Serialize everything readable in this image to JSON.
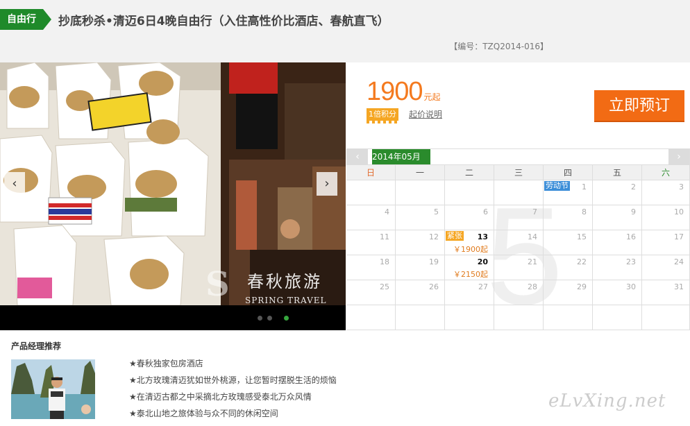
{
  "header": {
    "tag": "自由行",
    "title": "抄底秒杀•清迈6日4晚自由行（入住高性价比酒店、春航直飞）",
    "code": "【编号：TZQ2014-016】"
  },
  "gallery": {
    "prev_glyph": "‹",
    "next_glyph": "›",
    "watermark_cn": "春秋旅游",
    "watermark_en": "SPRING TRAVEL",
    "watermark_logo": "S",
    "dots": 3,
    "active_dot": 3
  },
  "pricing": {
    "amount": "1900",
    "unit": "元起",
    "points": "1倍积分",
    "note": "起价说明",
    "book_label": "立即预订",
    "accent": "#f47a1f",
    "button_color": "#f26b14"
  },
  "calendar": {
    "month": "2014年05月",
    "big_digit": "5",
    "prev_glyph": "‹",
    "next_glyph": "›",
    "weekdays": [
      "日",
      "一",
      "二",
      "三",
      "四",
      "五",
      "六"
    ],
    "days": [
      [
        "",
        "",
        "",
        "",
        "1",
        "2",
        "3"
      ],
      [
        "4",
        "5",
        "6",
        "7",
        "8",
        "9",
        "10"
      ],
      [
        "11",
        "12",
        "13",
        "14",
        "15",
        "16",
        "17"
      ],
      [
        "18",
        "19",
        "20",
        "21",
        "22",
        "23",
        "24"
      ],
      [
        "25",
        "26",
        "27",
        "28",
        "29",
        "30",
        "31"
      ],
      [
        "",
        "",
        "",
        "",
        "",
        "",
        ""
      ]
    ],
    "holiday_label": "劳动节",
    "tight_label": "紧张",
    "price_13": "￥1900起",
    "price_20": "￥2150起",
    "header_color": "#2a8b2c"
  },
  "recommendation": {
    "title": "产品经理推荐",
    "items": [
      "★春秋独家包房酒店",
      "★北方玫瑰清迈犹如世外桃源，让您暂时摆脱生活的烦恼",
      "★在清迈古都之中采摘北方玫瑰感受泰北万众风情",
      "★泰北山地之旅体验与众不同的休闲空间"
    ]
  },
  "brand_watermark": "eLvXing.net"
}
